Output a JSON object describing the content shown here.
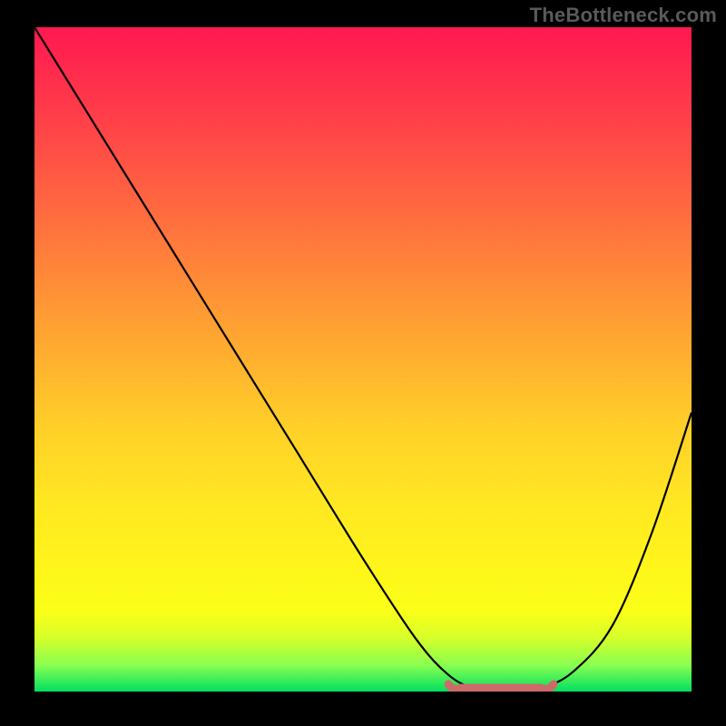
{
  "watermark": "TheBottleneck.com",
  "chart_data": {
    "type": "line",
    "title": "",
    "xlabel": "",
    "ylabel": "",
    "xlim": [
      0,
      100
    ],
    "ylim": [
      0,
      100
    ],
    "series": [
      {
        "name": "curve",
        "x": [
          0,
          10,
          20,
          30,
          40,
          50,
          58,
          63,
          67,
          72,
          77,
          82,
          88,
          94,
          100
        ],
        "y": [
          100,
          84,
          68,
          52,
          36,
          20,
          8,
          2.5,
          0.5,
          0,
          0.5,
          3,
          10,
          24,
          42
        ]
      }
    ],
    "annotations": [
      {
        "name": "trough-marker",
        "x_start": 63,
        "x_end": 79,
        "y": 0,
        "color": "#cf6a6a"
      }
    ],
    "background": "vertical-gradient red→yellow→green"
  }
}
